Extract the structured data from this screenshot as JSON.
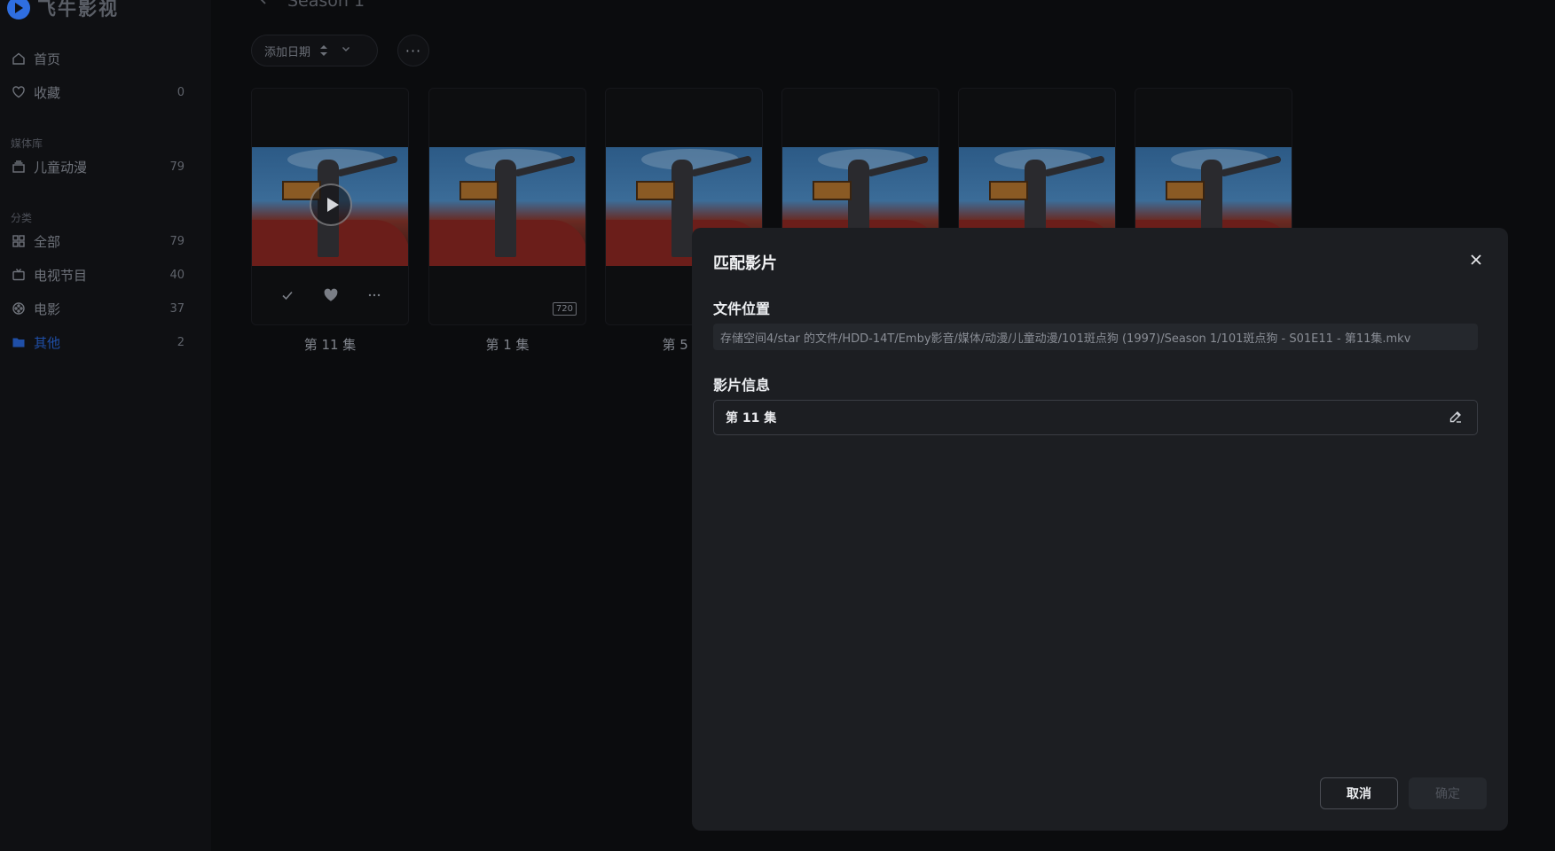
{
  "app": {
    "name": "飞牛影视"
  },
  "sidebar": {
    "home": {
      "label": "首页"
    },
    "favorites": {
      "label": "收藏",
      "count": "0"
    },
    "library_section": "媒体库",
    "library_items": [
      {
        "label": "儿童动漫",
        "count": "79"
      }
    ],
    "category_section": "分类",
    "category_items": [
      {
        "label": "全部",
        "count": "79"
      },
      {
        "label": "电视节目",
        "count": "40"
      },
      {
        "label": "电影",
        "count": "37"
      },
      {
        "label": "其他",
        "count": "2"
      }
    ]
  },
  "header": {
    "title": "Season 1"
  },
  "toolbar": {
    "sort_label": "添加日期",
    "more_label": "···"
  },
  "cards": [
    {
      "title": "第 11 集"
    },
    {
      "title": "第 1 集",
      "badge": "720"
    },
    {
      "title": "第 5 集"
    },
    {
      "title": ""
    },
    {
      "title": ""
    },
    {
      "title": ""
    }
  ],
  "modal": {
    "title": "匹配影片",
    "file_location_label": "文件位置",
    "file_path": "存储空间4/star 的文件/HDD-14T/Emby影音/媒体/动漫/儿童动漫/101斑点狗 (1997)/Season 1/101斑点狗 - S01E11 - 第11集.mkv",
    "info_label": "影片信息",
    "info_value": "第 11 集",
    "cancel_label": "取消",
    "ok_label": "确定"
  }
}
